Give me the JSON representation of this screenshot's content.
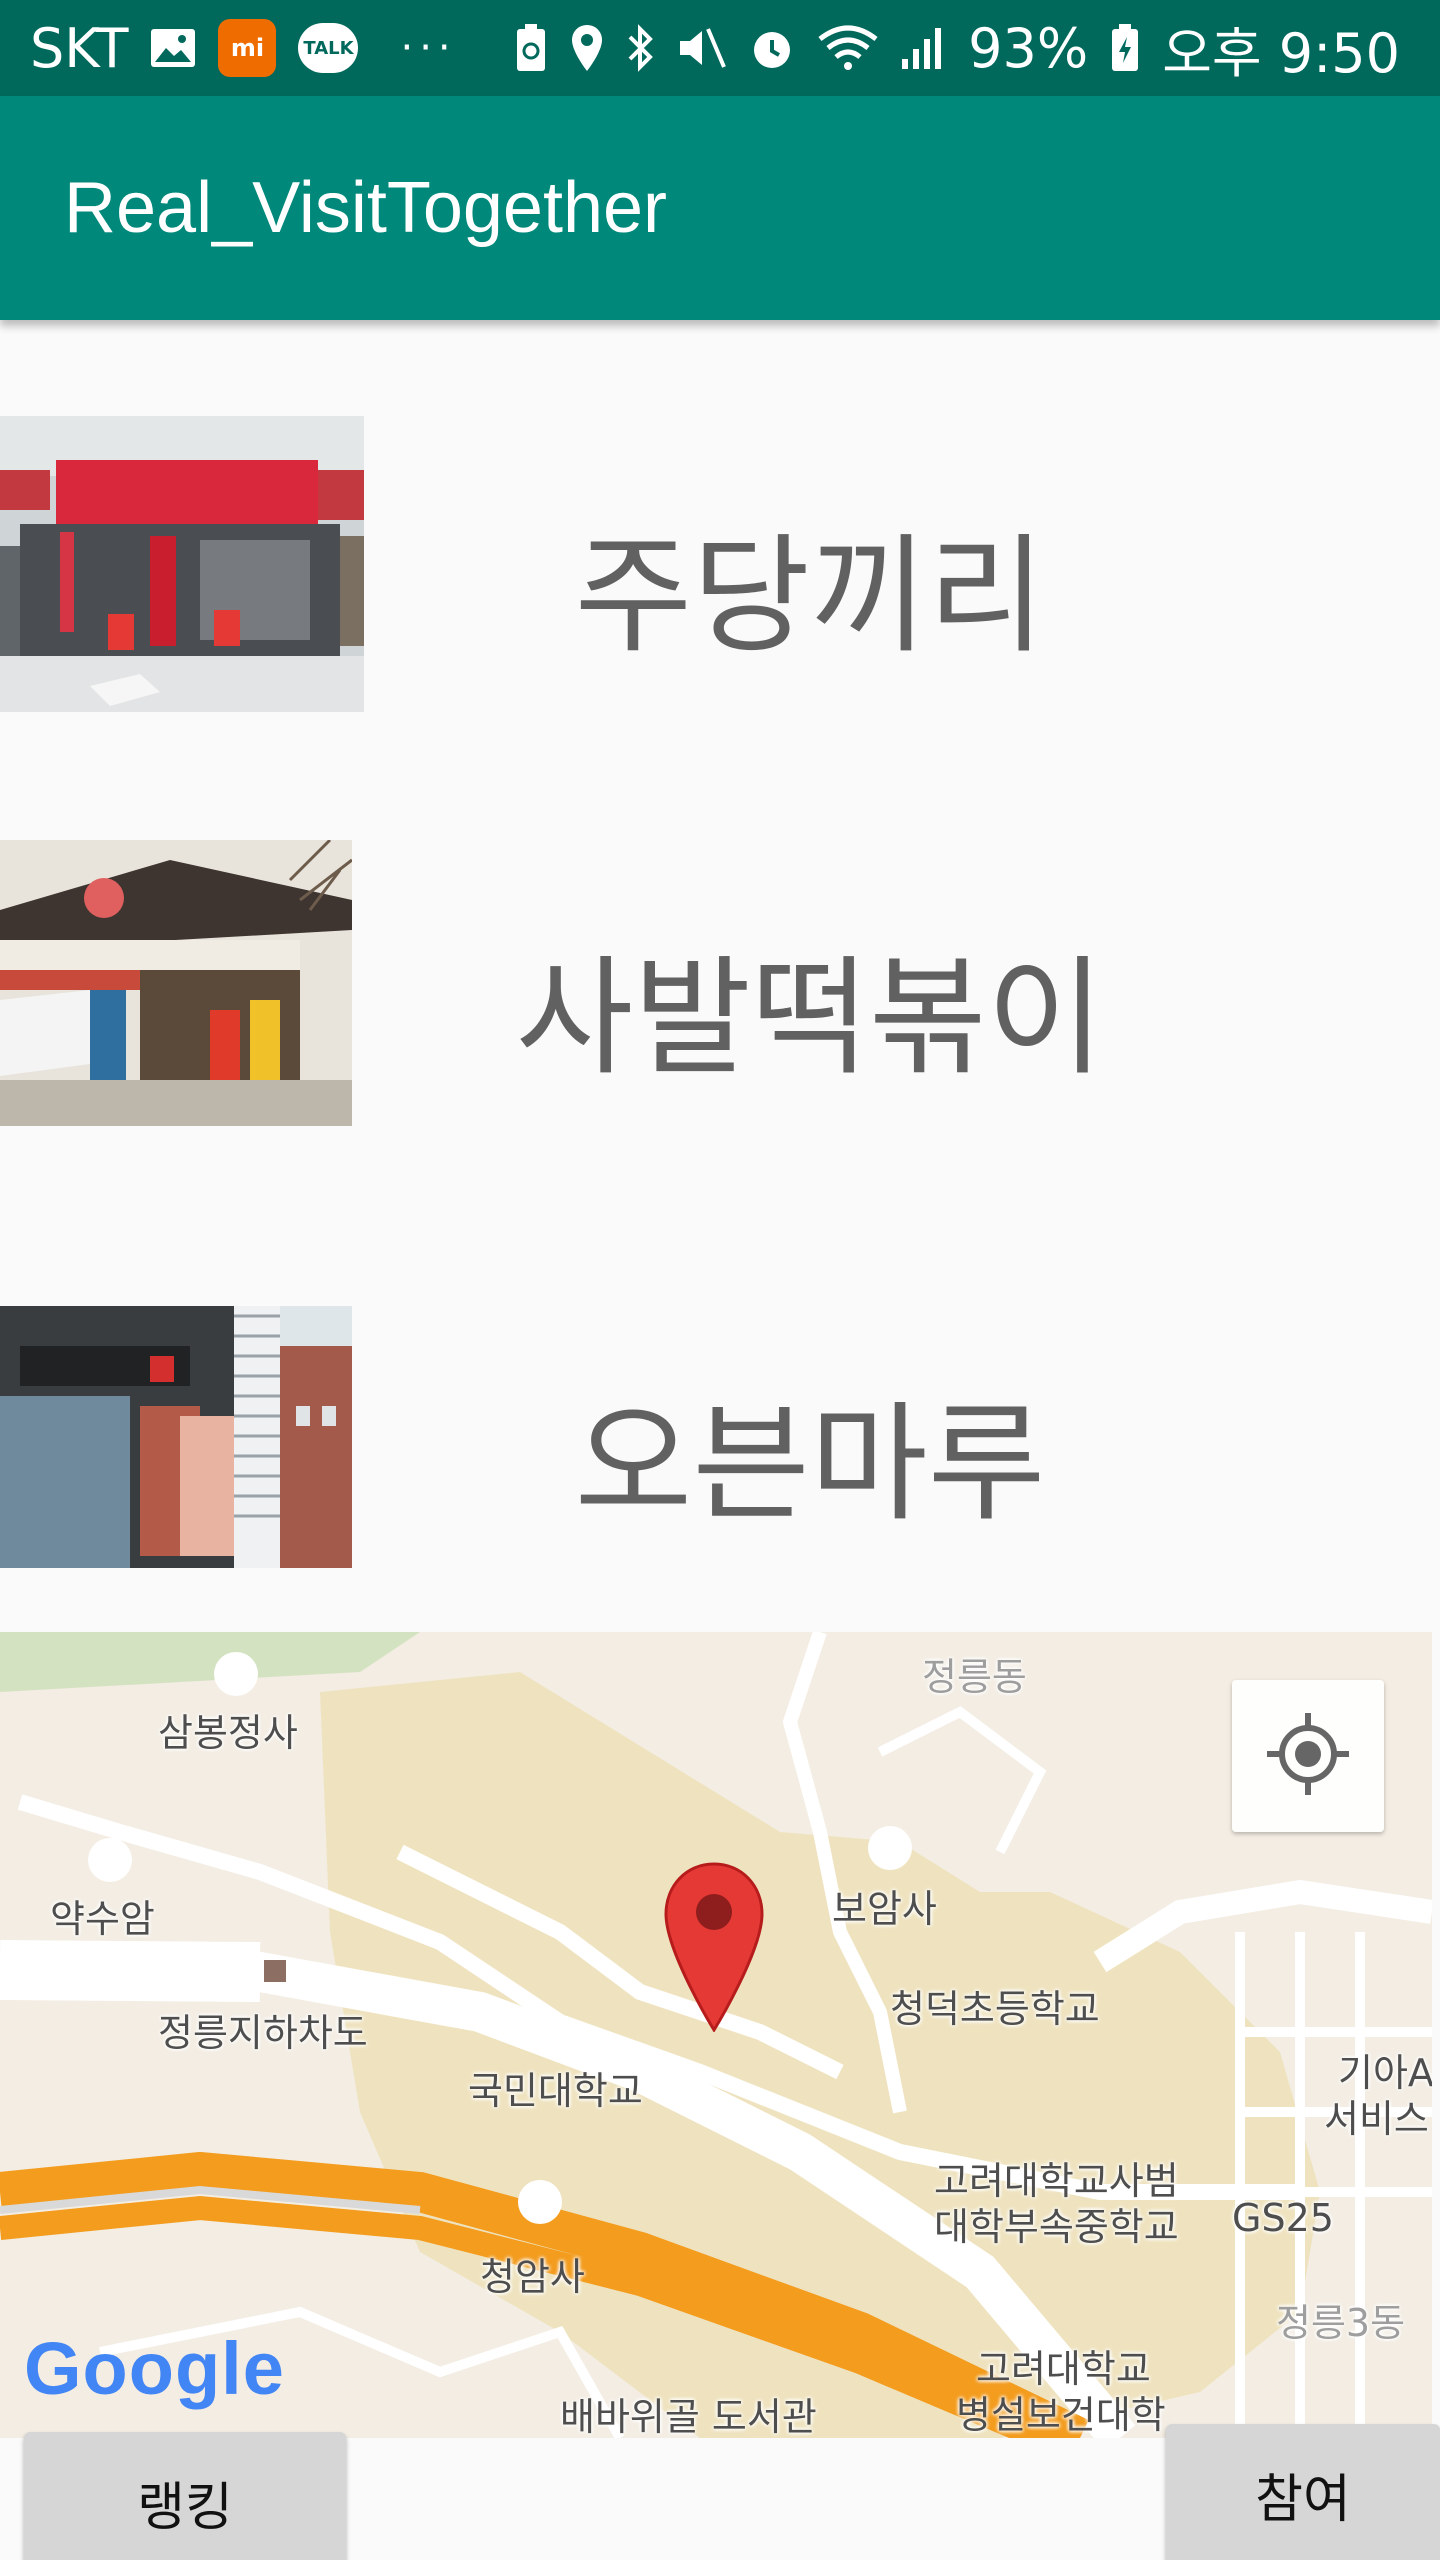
{
  "status_bar": {
    "carrier": "SKT",
    "mi_badge": "mi",
    "talk_badge": "TALK",
    "more": "···",
    "battery": "93%",
    "time": "오후 9:50"
  },
  "app_bar": {
    "title": "Real_VisitTogether"
  },
  "restaurants": [
    {
      "name": "주당끼리"
    },
    {
      "name": "사발떡볶이"
    },
    {
      "name": "오븐마루"
    }
  ],
  "map": {
    "labels": {
      "l1": "정릉동",
      "l2": "삼봉정사",
      "l3": "약수암",
      "l4": "보암사",
      "l5": "정릉지하차도",
      "l6": "청덕초등학교",
      "l7": "국민대학교",
      "l8": "기아A",
      "l9": "서비스",
      "l10": "고려대학교사범",
      "l11": "대학부속중학교",
      "l12": "GS25",
      "l13": "청암사",
      "l14": "정릉3동",
      "l15": "고려대학교",
      "l16": "병설보건대학",
      "l17": "배바위골 도서관"
    },
    "logo": "Google"
  },
  "buttons": {
    "ranking": "랭킹",
    "join": "참여"
  }
}
